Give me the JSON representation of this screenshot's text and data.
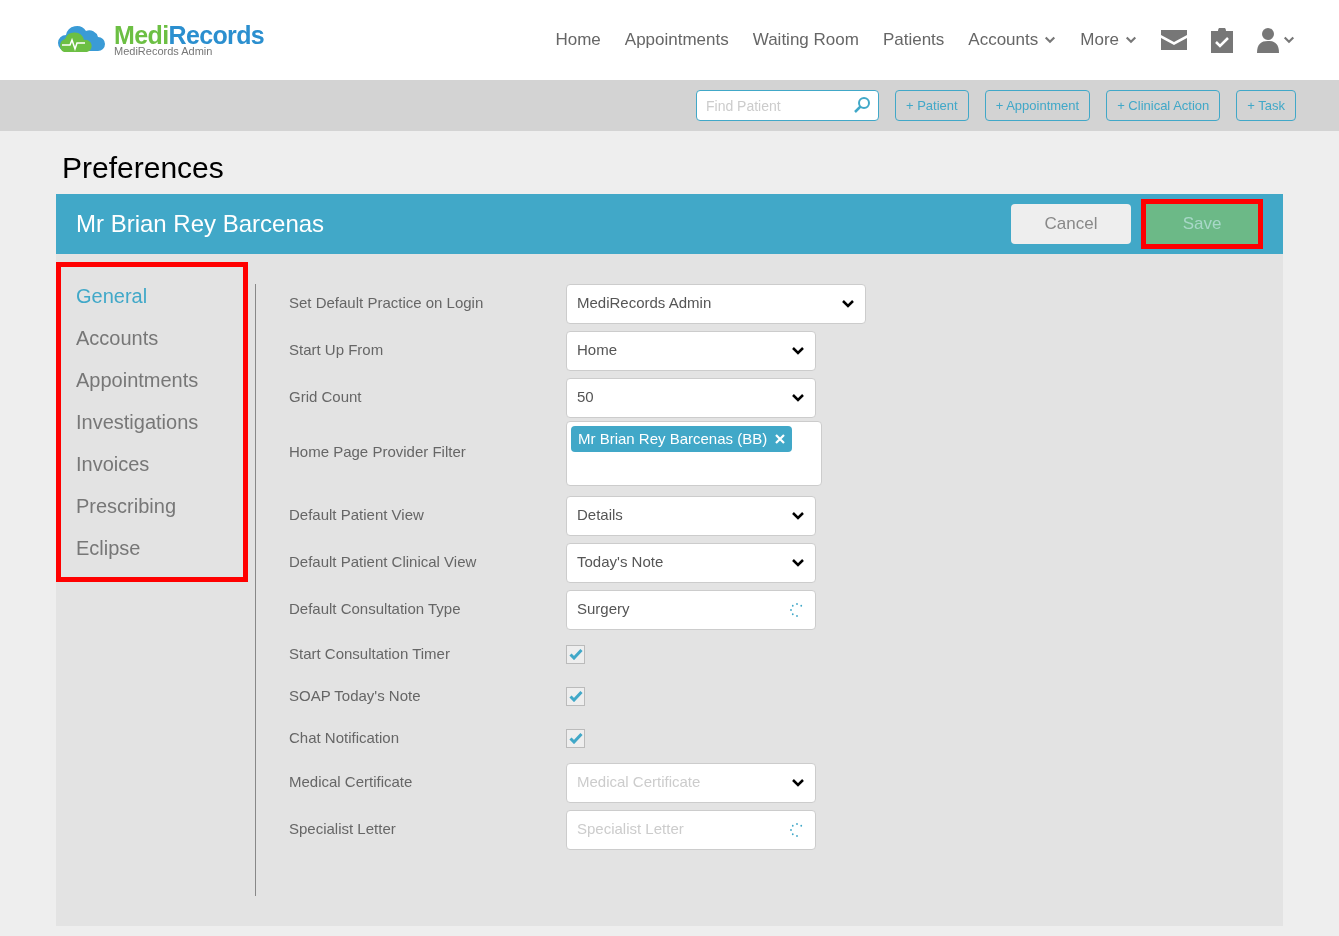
{
  "brand": {
    "name_part1": "Medi",
    "name_part2": "Records",
    "subtitle": "MediRecords Admin"
  },
  "nav": [
    {
      "label": "Home",
      "dropdown": false
    },
    {
      "label": "Appointments",
      "dropdown": false
    },
    {
      "label": "Waiting Room",
      "dropdown": false
    },
    {
      "label": "Patients",
      "dropdown": false
    },
    {
      "label": "Accounts",
      "dropdown": true
    },
    {
      "label": "More",
      "dropdown": true
    }
  ],
  "toolbar": {
    "search": {
      "placeholder": "Find Patient"
    },
    "buttons": [
      "+ Patient",
      "+ Appointment",
      "+ Clinical Action",
      "+ Task"
    ]
  },
  "page_title": "Preferences",
  "header": {
    "name": "Mr Brian Rey Barcenas",
    "cancel": "Cancel",
    "save": "Save",
    "save_highlighted": true
  },
  "sidebar": {
    "highlighted": true,
    "items": [
      {
        "label": "General",
        "selected": true
      },
      {
        "label": "Accounts",
        "selected": false
      },
      {
        "label": "Appointments",
        "selected": false
      },
      {
        "label": "Investigations",
        "selected": false
      },
      {
        "label": "Invoices",
        "selected": false
      },
      {
        "label": "Prescribing",
        "selected": false
      },
      {
        "label": "Eclipse",
        "selected": false
      }
    ]
  },
  "settings": [
    {
      "label": "Set Default Practice on Login",
      "kind": "select",
      "wide": true,
      "value": "MediRecords Admin"
    },
    {
      "label": "Start Up From",
      "kind": "select",
      "value": "Home"
    },
    {
      "label": "Grid Count",
      "kind": "select",
      "value": "50"
    },
    {
      "label": "Home Page Provider Filter",
      "kind": "tags",
      "tags": [
        "Mr Brian Rey Barcenas (BB)"
      ]
    },
    {
      "label": "Default Patient View",
      "kind": "select",
      "value": "Details"
    },
    {
      "label": "Default Patient Clinical View",
      "kind": "select",
      "value": "Today's Note"
    },
    {
      "label": "Default Consultation Type",
      "kind": "lookup",
      "value": "Surgery"
    },
    {
      "label": "Start Consultation Timer",
      "kind": "checkbox",
      "checked": true
    },
    {
      "label": "SOAP Today's Note",
      "kind": "checkbox",
      "checked": true
    },
    {
      "label": "Chat Notification",
      "kind": "checkbox",
      "checked": true
    },
    {
      "label": "Medical Certificate",
      "kind": "select",
      "placeholder": "Medical Certificate"
    },
    {
      "label": "Specialist Letter",
      "kind": "lookup",
      "placeholder": "Specialist Letter"
    }
  ]
}
